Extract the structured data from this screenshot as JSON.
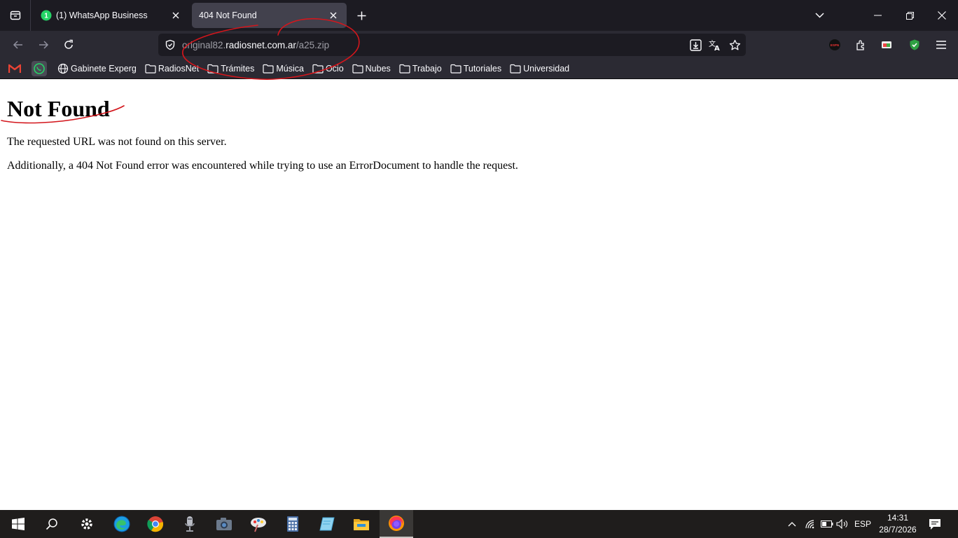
{
  "browser": {
    "tabs": [
      {
        "title": "(1) WhatsApp Business",
        "badge": "1",
        "active": false
      },
      {
        "title": "404 Not Found",
        "active": true
      }
    ],
    "url": {
      "prefix": "original82.",
      "host": "radiosnet.com.ar",
      "path": "/a25.zip"
    },
    "bookmarks": [
      {
        "label": "Gabinete Experg",
        "icon": "globe-icon"
      },
      {
        "label": "RadiosNet",
        "icon": "folder-icon"
      },
      {
        "label": "Trámites",
        "icon": "folder-icon"
      },
      {
        "label": "Música",
        "icon": "folder-icon"
      },
      {
        "label": "Ocio",
        "icon": "folder-icon"
      },
      {
        "label": "Nubes",
        "icon": "folder-icon"
      },
      {
        "label": "Trabajo",
        "icon": "folder-icon"
      },
      {
        "label": "Tutoriales",
        "icon": "folder-icon"
      },
      {
        "label": "Universidad",
        "icon": "folder-icon"
      }
    ]
  },
  "page": {
    "heading": "Not Found",
    "message1": "The requested URL was not found on this server.",
    "message2": "Additionally, a 404 Not Found error was encountered while trying to use an ErrorDocument to handle the request."
  },
  "taskbar": {
    "language": "ESP",
    "time": "14:31",
    "date": "28/7/2026",
    "apps": [
      "start-icon",
      "search-icon",
      "settings-icon",
      "edge-icon",
      "chrome-icon",
      "microphone-icon",
      "camera-icon",
      "paint-icon",
      "calculator-icon",
      "notepad-icon",
      "file-explorer-icon",
      "firefox-icon"
    ]
  },
  "colors": {
    "tabbar_bg": "#1c1b22",
    "toolbar_bg": "#2b2a33",
    "urlbar_bg": "#1c1b22",
    "annotation": "#d3161c",
    "whatsapp": "#25d366"
  }
}
